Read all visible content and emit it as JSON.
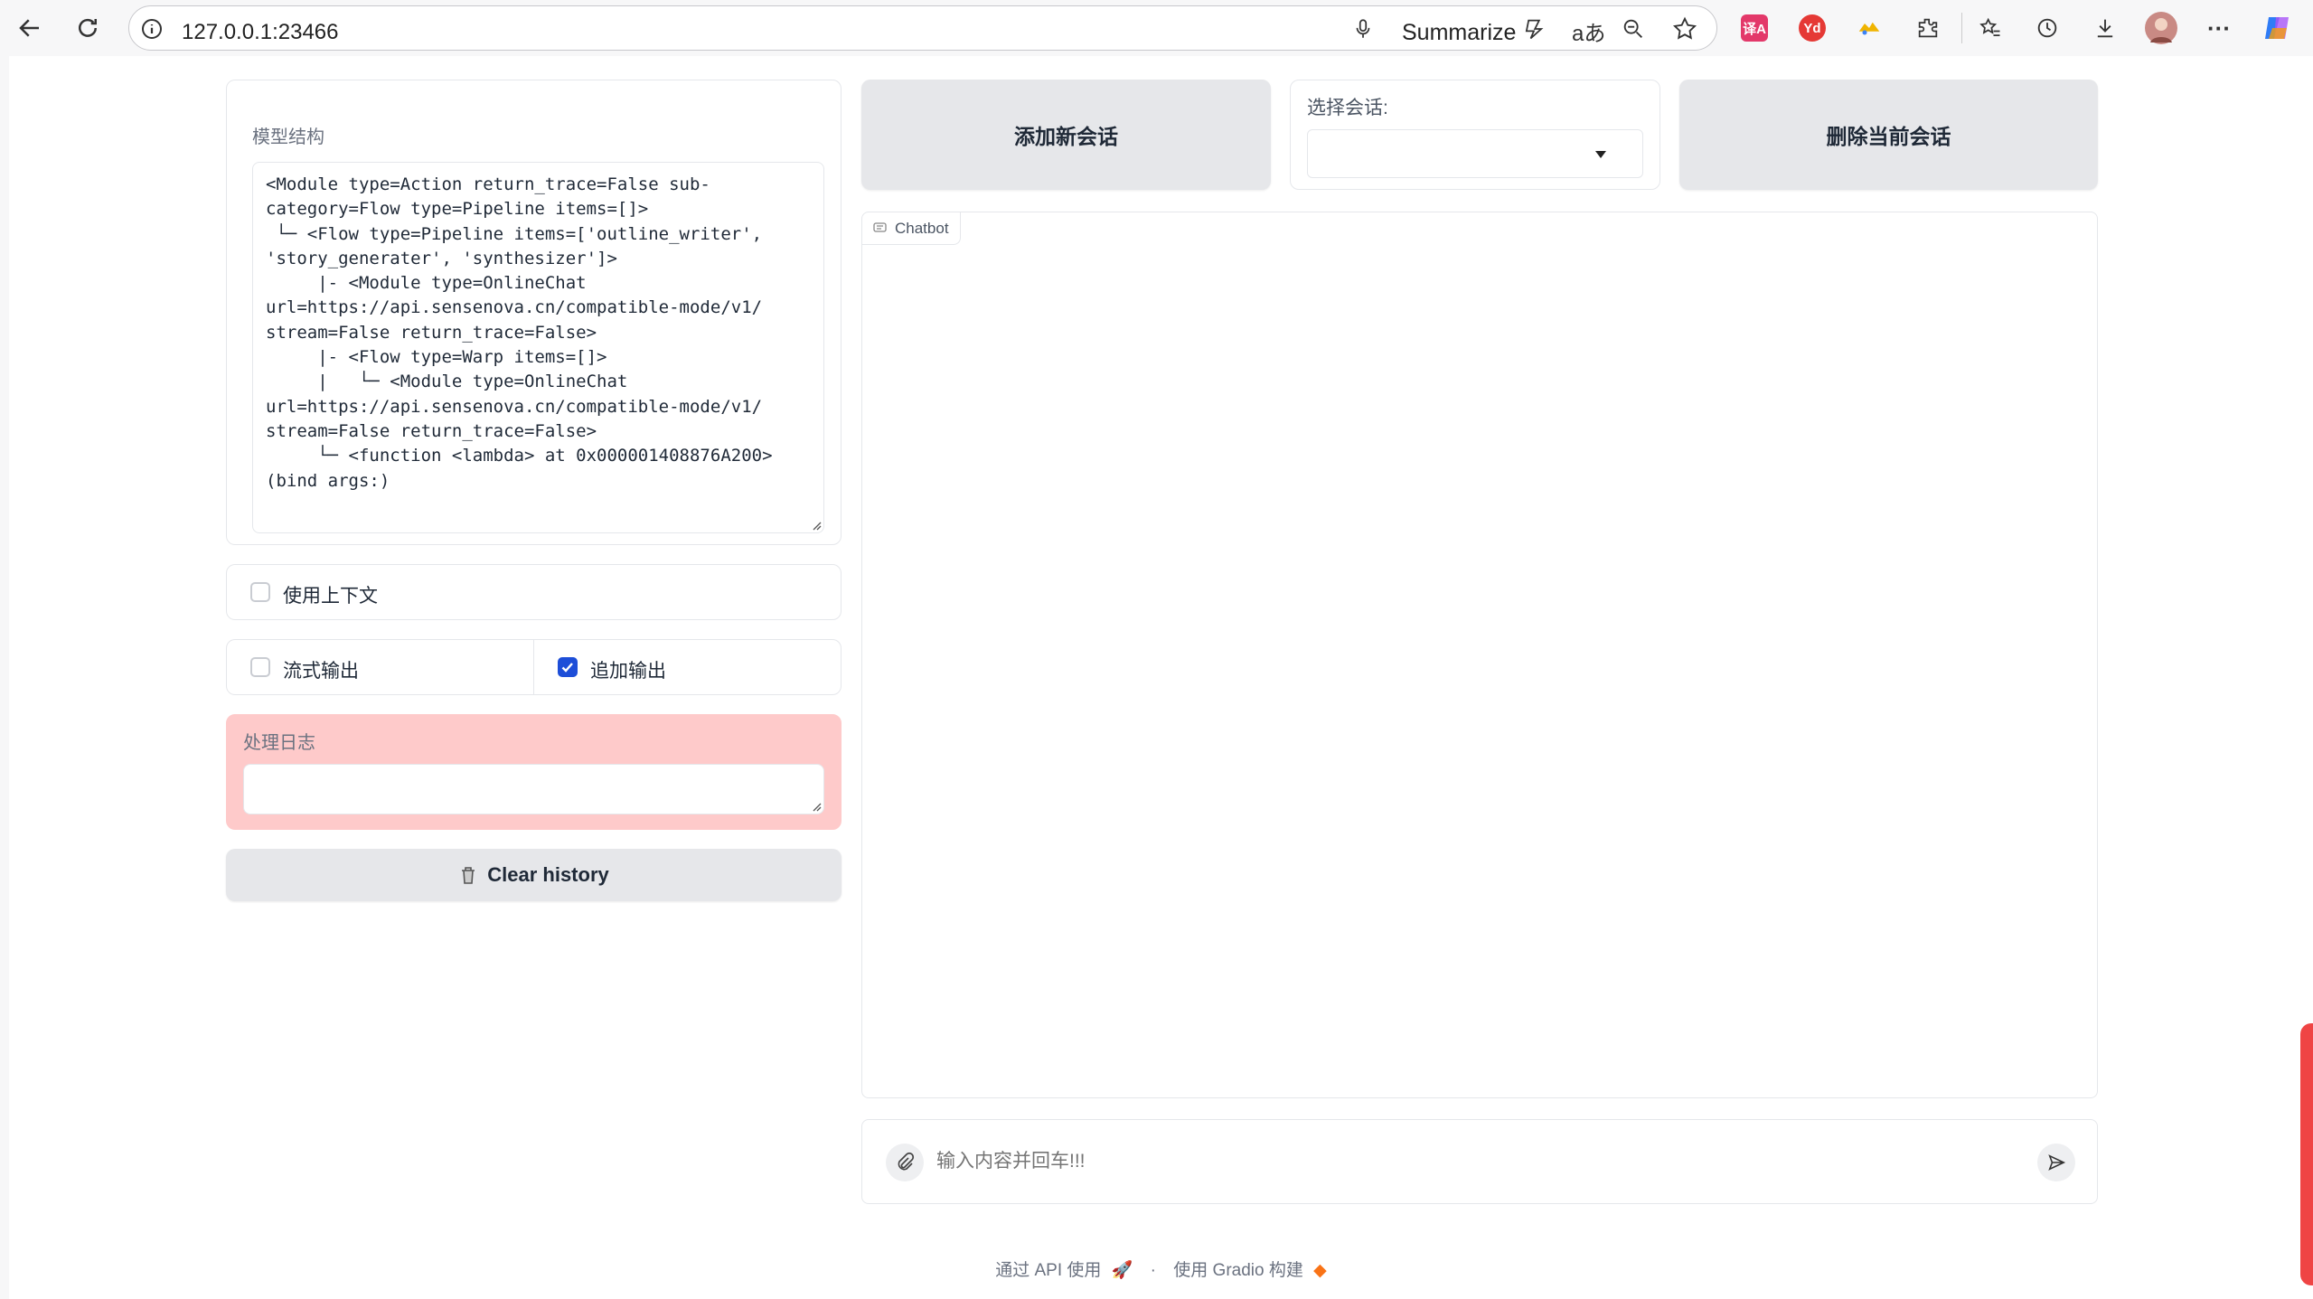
{
  "browser": {
    "url": "127.0.0.1:23466",
    "summarize_label": "Summarize",
    "icons": [
      "back-arrow-icon",
      "reload-icon",
      "info-icon",
      "mic-icon",
      "copilot-icon",
      "read-aloud-icon",
      "zoom-icon",
      "star-icon",
      "translate-ext-icon",
      "youdao-ext-icon",
      "ext-icon",
      "extensions-icon",
      "favorites-icon",
      "history-icon",
      "download-icon",
      "profile-avatar",
      "more-icon",
      "copilot-logo-icon"
    ],
    "ext_labels": {
      "translate": "译A",
      "youdao": "Yd"
    }
  },
  "left": {
    "model_structure": {
      "label": "模型结构",
      "value": "<Module type=Action return_trace=False sub-\ncategory=Flow type=Pipeline items=[]>\n └─ <Flow type=Pipeline items=['outline_writer',\n'story_generater', 'synthesizer']>\n     |- <Module type=OnlineChat\nurl=https://api.sensenova.cn/compatible-mode/v1/\nstream=False return_trace=False>\n     |- <Flow type=Warp items=[]>\n     |   └─ <Module type=OnlineChat\nurl=https://api.sensenova.cn/compatible-mode/v1/\nstream=False return_trace=False>\n     └─ <function <lambda> at 0x000001408876A200>\n(bind args:)"
    },
    "use_context": {
      "label": "使用上下文",
      "checked": false
    },
    "stream_output": {
      "label": "流式输出",
      "checked": false
    },
    "append_output": {
      "label": "追加输出",
      "checked": true
    },
    "log": {
      "label": "处理日志",
      "value": ""
    },
    "clear_history_label": "Clear history"
  },
  "right": {
    "add_session_label": "添加新会话",
    "select_session": {
      "label": "选择会话:",
      "value": ""
    },
    "delete_session_label": "删除当前会话",
    "chatbot_label": "Chatbot",
    "input_placeholder": "输入内容并回车!!!"
  },
  "footer": {
    "api_text": "通过 API 使用",
    "separator": "·",
    "gradio_text": "使用 Gradio 构建"
  },
  "colors": {
    "accent": "#1d4ed8",
    "log_bg": "#fecaca",
    "button_bg": "#e6e7ea"
  }
}
